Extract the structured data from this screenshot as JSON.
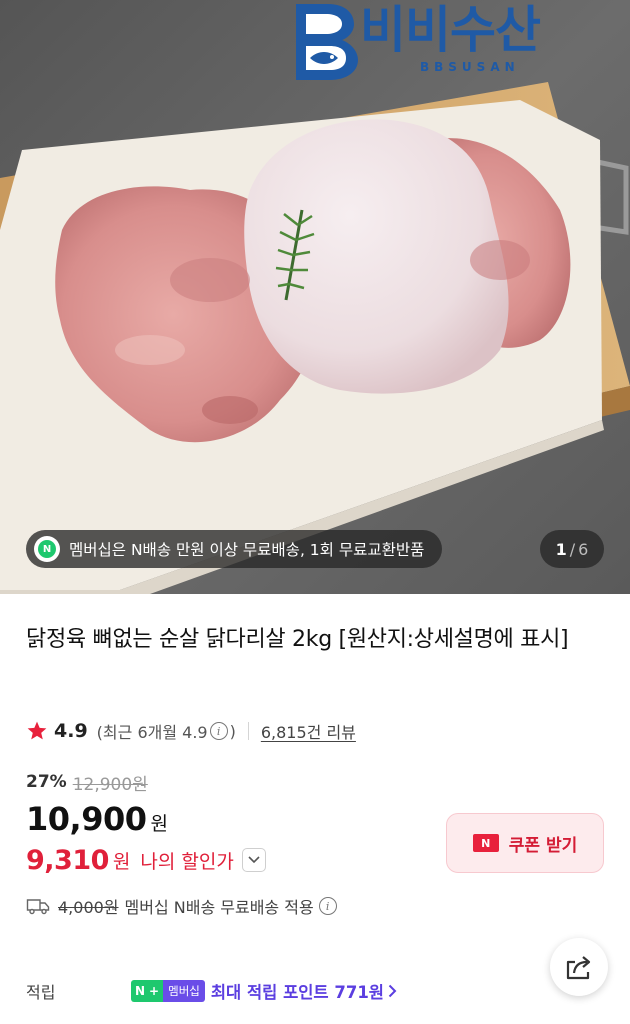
{
  "hero": {
    "logo_text": "비비수산",
    "logo_subtext": "BBSUSAN",
    "promo_badge": "N",
    "promo_text": "멤버십은 N배송 만원 이상 무료배송, 1회 무료교환반품",
    "counter_current": "1",
    "counter_separator": "/",
    "counter_total": "6"
  },
  "product": {
    "title": "닭정육 뼈없는 순살 닭다리살 2kg [원산지:상세설명에 표시]",
    "rating": "4.9",
    "recent_rating_prefix": "(최근 6개월 4.9",
    "recent_rating_suffix": ")",
    "review_count": "6,815건 리뷰",
    "discount_rate": "27%",
    "original_price": "12,900원",
    "price": "10,900",
    "price_unit": "원",
    "my_price": "9,310",
    "my_price_unit": "원",
    "my_price_label": "나의 할인가"
  },
  "coupon": {
    "badge": "N",
    "label": "쿠폰 받기"
  },
  "shipping": {
    "original_fee": "4,000원",
    "text": "멤버십 N배송 무료배송 적용"
  },
  "points": {
    "label": "적립",
    "badge_n": "N",
    "badge_plus": "+",
    "badge_member": "멤버십",
    "text": "최대 적립 포인트 771원"
  },
  "icons": {
    "star": "star-icon",
    "info": "info-icon",
    "chevron_down": "chevron-down-icon",
    "truck": "truck-icon",
    "share": "share-icon",
    "chevron_right": "chevron-right-icon"
  },
  "colors": {
    "brand_blue": "#1f5aa6",
    "sale_red": "#e0203a",
    "naver_green": "#1ec86e",
    "membership_purple": "#5b3ee0"
  }
}
